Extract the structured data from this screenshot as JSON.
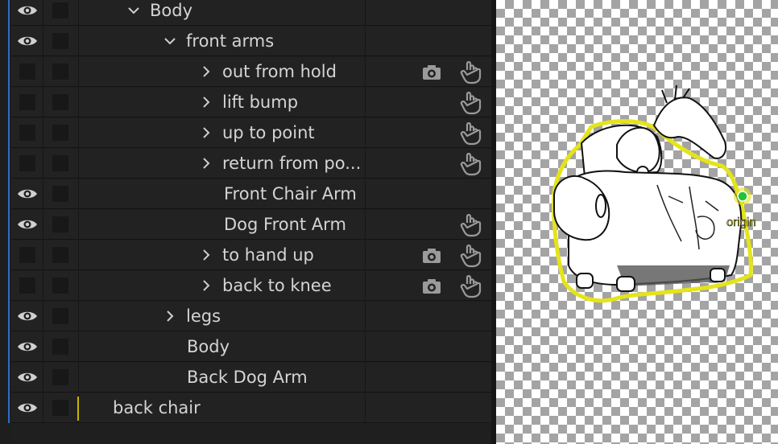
{
  "rows": [
    {
      "label": "Body",
      "visible": true,
      "expander": "open",
      "cam": false,
      "hand": false
    },
    {
      "label": "front arms",
      "visible": true,
      "expander": "open",
      "cam": false,
      "hand": false
    },
    {
      "label": "out from hold",
      "visible": false,
      "expander": "closed",
      "cam": true,
      "hand": true
    },
    {
      "label": "lift bump",
      "visible": false,
      "expander": "closed",
      "cam": false,
      "hand": true
    },
    {
      "label": "up to point",
      "visible": false,
      "expander": "closed",
      "cam": false,
      "hand": true
    },
    {
      "label": "return from po...",
      "visible": false,
      "expander": "closed",
      "cam": false,
      "hand": true
    },
    {
      "label": "Front Chair Arm",
      "visible": true,
      "expander": "none",
      "cam": false,
      "hand": false
    },
    {
      "label": "Dog Front Arm",
      "visible": true,
      "expander": "none",
      "cam": false,
      "hand": true
    },
    {
      "label": "to hand up",
      "visible": false,
      "expander": "closed",
      "cam": true,
      "hand": true
    },
    {
      "label": "back to knee",
      "visible": false,
      "expander": "closed",
      "cam": true,
      "hand": true
    },
    {
      "label": "legs",
      "visible": true,
      "expander": "closed",
      "cam": false,
      "hand": false
    },
    {
      "label": "Body",
      "visible": true,
      "expander": "none",
      "cam": false,
      "hand": false
    },
    {
      "label": "Back Dog Arm",
      "visible": true,
      "expander": "none",
      "cam": false,
      "hand": false
    },
    {
      "label": "back chair",
      "visible": true,
      "expander": "none",
      "cam": false,
      "hand": false,
      "selected_marker": true
    }
  ],
  "scene": {
    "origin_label": "origin",
    "origin_color": "#22c33a",
    "outline_color": "#e4e41a"
  },
  "colors": {
    "text": "#d4d4d4",
    "icon": "#d0d0d0",
    "dim_icon": "#9a9a9a",
    "accent_blue": "#2b6fbf"
  }
}
